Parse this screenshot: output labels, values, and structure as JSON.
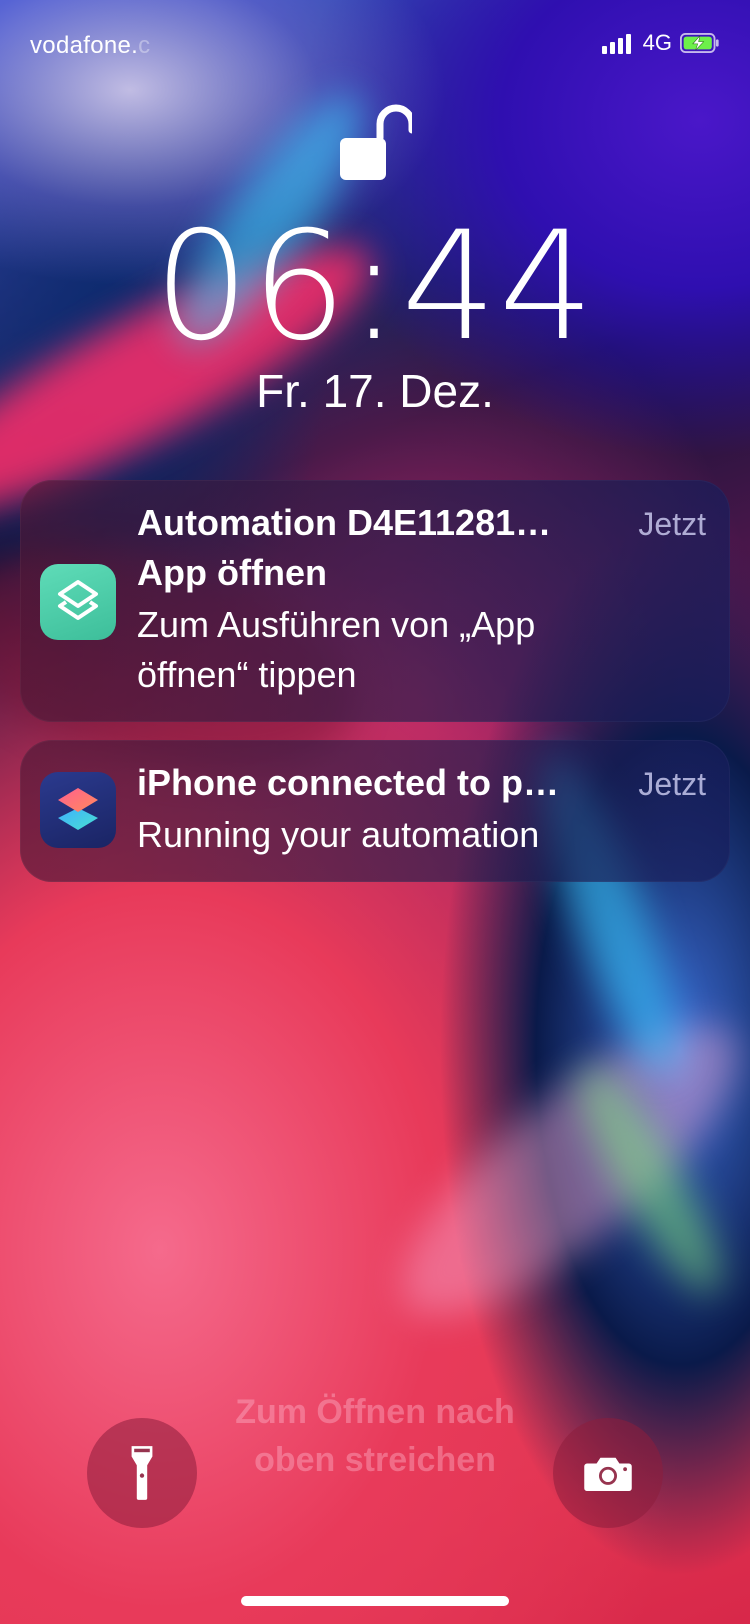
{
  "status_bar": {
    "carrier": "vodafone.",
    "carrier_suffix": "c",
    "network": "4G",
    "signal_bars": 4,
    "battery_charging": true,
    "battery_color": "#6df04a"
  },
  "lock_screen": {
    "lock_icon": "unlocked-padlock-icon",
    "time": "06:44",
    "date": "Fr. 17. Dez."
  },
  "notifications": [
    {
      "app_icon": "shortcuts-automation-icon",
      "icon_color": "#4fcfa9",
      "title": "Automation D4E11281…",
      "time": "Jetzt",
      "subtitle": "App öffnen",
      "text": "Zum Ausführen von „App öffnen“ tippen"
    },
    {
      "app_icon": "shortcuts-icon",
      "icon_color": "#232d78",
      "title": "iPhone connected to p…",
      "time": "Jetzt",
      "text": "Running your automation"
    }
  ],
  "quick_actions": {
    "flashlight_icon": "flashlight-icon",
    "camera_icon": "camera-icon"
  },
  "swipe_hint": "Zum Öffnen nach oben streichen"
}
